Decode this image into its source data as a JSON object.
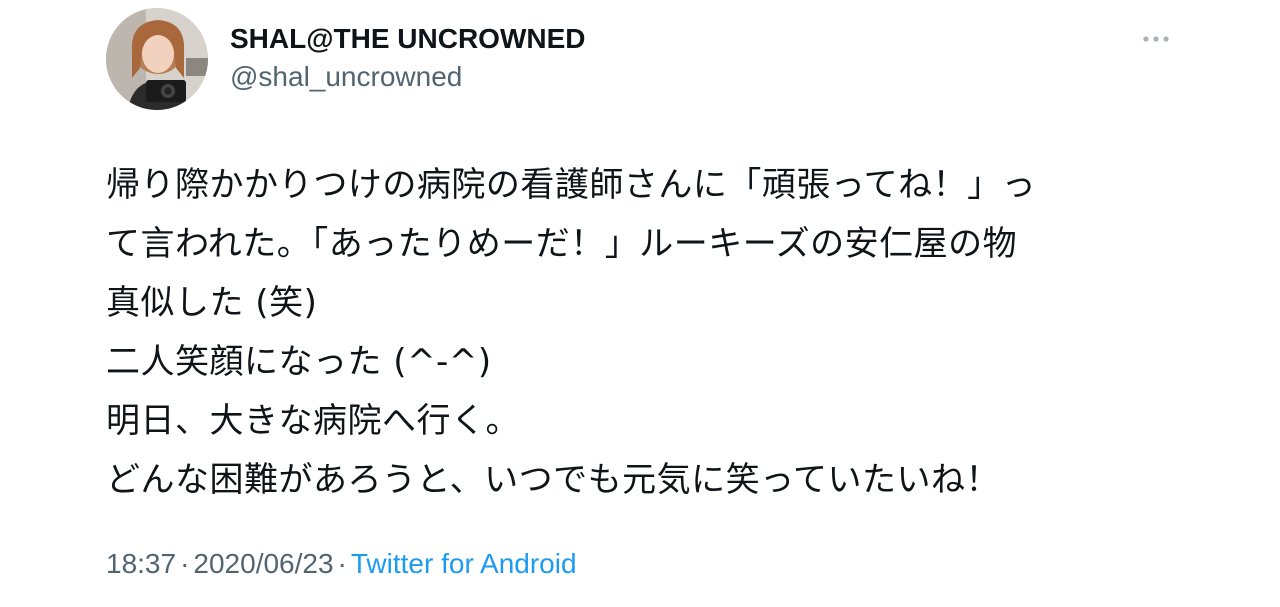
{
  "tweet": {
    "author": {
      "display_name": "SHAL@THE UNCROWNED",
      "handle": "@shal_uncrowned",
      "avatar_icon": "user-avatar-photo"
    },
    "more_icon": "more-horizontal-icon",
    "lines": [
      "帰り際かかりつけの病院の看護師さんに「頑張ってね！」っ",
      "て言われた。「あったりめーだ！」ルーキーズの安仁屋の物",
      "真似した (笑)",
      "二人笑顔になった (^-^)",
      "明日、大きな病院へ行く。",
      "どんな困難があろうと、いつでも元気に笑っていたいね！"
    ],
    "meta": {
      "time": "18:37",
      "separator": "·",
      "date": "2020/06/23",
      "source": "Twitter for Android"
    }
  },
  "colors": {
    "text_primary": "#0f1419",
    "text_secondary": "#536471",
    "link": "#1d9bf0",
    "background": "#ffffff"
  }
}
